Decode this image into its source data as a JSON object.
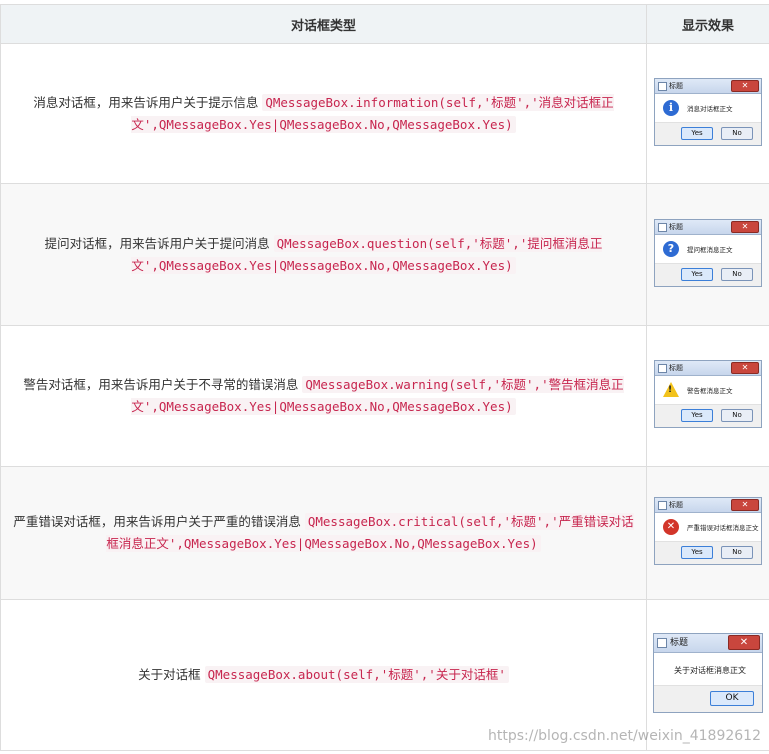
{
  "header": {
    "col1": "对话框类型",
    "col2": "显示效果"
  },
  "rows": [
    {
      "text": "消息对话框，用来告诉用户关于提示信息 ",
      "code": "QMessageBox.information(self,'标题','消息对话框正文',QMessageBox.Yes|QMessageBox.No,QMessageBox.Yes)",
      "dialog": {
        "title": "标题",
        "message": "消息对话框正文",
        "icon": "information-icon",
        "yes": "Yes",
        "no": "No"
      }
    },
    {
      "text": "提问对话框，用来告诉用户关于提问消息 ",
      "code": "QMessageBox.question(self,'标题','提问框消息正文',QMessageBox.Yes|QMessageBox.No,QMessageBox.Yes)",
      "dialog": {
        "title": "标题",
        "message": "提问框消息正文",
        "icon": "question-icon",
        "yes": "Yes",
        "no": "No"
      }
    },
    {
      "text": "警告对话框，用来告诉用户关于不寻常的错误消息 ",
      "code": "QMessageBox.warning(self,'标题','警告框消息正文',QMessageBox.Yes|QMessageBox.No,QMessageBox.Yes)",
      "dialog": {
        "title": "标题",
        "message": "警告框消息正文",
        "icon": "warning-icon",
        "yes": "Yes",
        "no": "No"
      }
    },
    {
      "text": "严重错误对话框，用来告诉用户关于严重的错误消息 ",
      "code": "QMessageBox.critical(self,'标题','严重错误对话框消息正文',QMessageBox.Yes|QMessageBox.No,QMessageBox.Yes)",
      "dialog": {
        "title": "标题",
        "message": "严重错误对话框消息正文",
        "icon": "critical-icon",
        "yes": "Yes",
        "no": "No"
      }
    },
    {
      "text": "关于对话框 ",
      "code": "QMessageBox.about(self,'标题','关于对话框'",
      "dialog": {
        "title": "标题",
        "message": "关于对话框消息正文",
        "ok": "OK"
      }
    }
  ],
  "watermark": "https://blog.csdn.net/weixin_41892612"
}
